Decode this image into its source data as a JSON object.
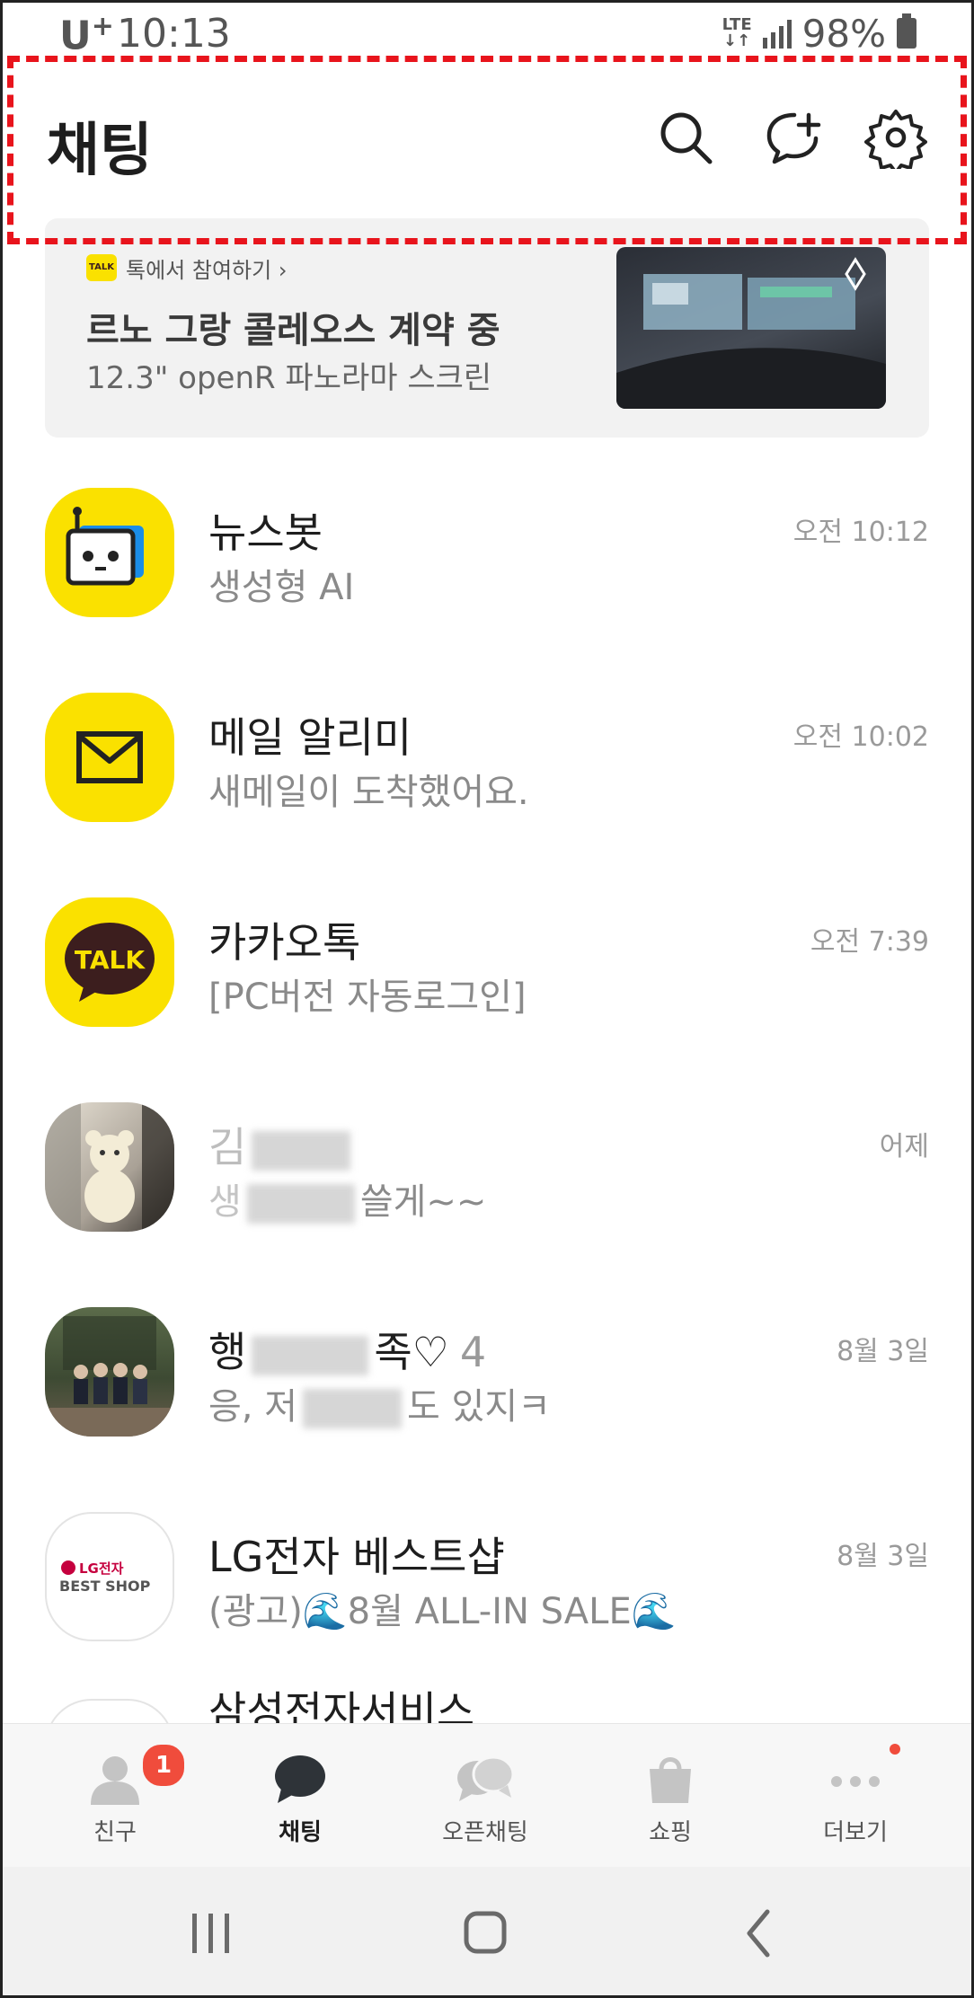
{
  "status_bar": {
    "carrier": "U",
    "carrier_plus": "+",
    "time": "10:13",
    "network": "LTE",
    "battery": "98%"
  },
  "header": {
    "title": "채팅",
    "icons": [
      "search-icon",
      "new-chat-icon",
      "settings-icon"
    ]
  },
  "ad": {
    "badge": "TALK",
    "source": "톡에서 참여하기 ›",
    "title": "르노 그랑 콜레오스 계약 중",
    "subtitle": "12.3\" openR 파노라마 스크린"
  },
  "chats": [
    {
      "name": "뉴스봇",
      "message": "생성형 AI",
      "time": "오전 10:12"
    },
    {
      "name": "메일 알리미",
      "message": "새메일이 도착했어요.",
      "time": "오전 10:02"
    },
    {
      "name": "카카오톡",
      "message": "[PC버전 자동로그인]",
      "time": "오전 7:39",
      "avatar_text": "TALK"
    },
    {
      "name_visible": "김",
      "message_visible_start": "생",
      "message_visible_end": "쓸게~~",
      "time": "어제"
    },
    {
      "name_visible_start": "행",
      "name_visible_end": "족♡",
      "member_count": "4",
      "message_visible_start": "응, 저",
      "message_visible_end": "도 있지ㅋ",
      "time": "8월 3일"
    },
    {
      "name": "LG전자 베스트샵",
      "message": "(광고)🌊8월 ALL-IN SALE🌊",
      "time": "8월 3일",
      "avatar_line1": "LG전자",
      "avatar_line2": "BEST SHOP"
    },
    {
      "name": "삼성전자서비스"
    }
  ],
  "tabs": [
    {
      "label": "친구",
      "badge": "1"
    },
    {
      "label": "채팅"
    },
    {
      "label": "오픈채팅"
    },
    {
      "label": "쇼핑"
    },
    {
      "label": "더보기"
    }
  ],
  "active_tab": "채팅",
  "colors": {
    "kakao_yellow": "#FAE100",
    "badge_red": "#F04C3C",
    "highlight": "#E8141C"
  }
}
